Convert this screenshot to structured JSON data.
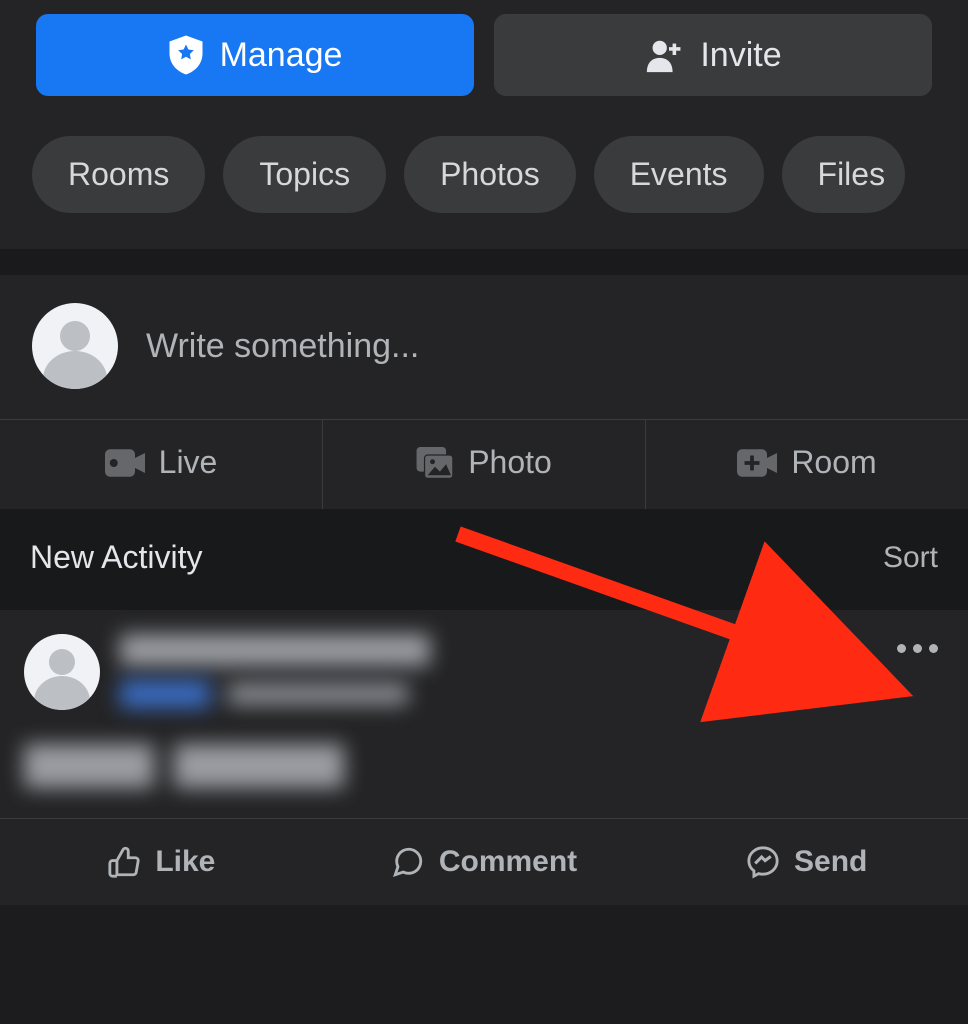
{
  "top_buttons": {
    "manage_label": "Manage",
    "invite_label": "Invite"
  },
  "nav": [
    "Rooms",
    "Topics",
    "Photos",
    "Events",
    "Files"
  ],
  "composer": {
    "placeholder": "Write something..."
  },
  "action_bar": {
    "live": "Live",
    "photo": "Photo",
    "room": "Room"
  },
  "activity": {
    "heading": "New Activity",
    "sort": "Sort"
  },
  "post_actions": {
    "like": "Like",
    "comment": "Comment",
    "send": "Send"
  }
}
